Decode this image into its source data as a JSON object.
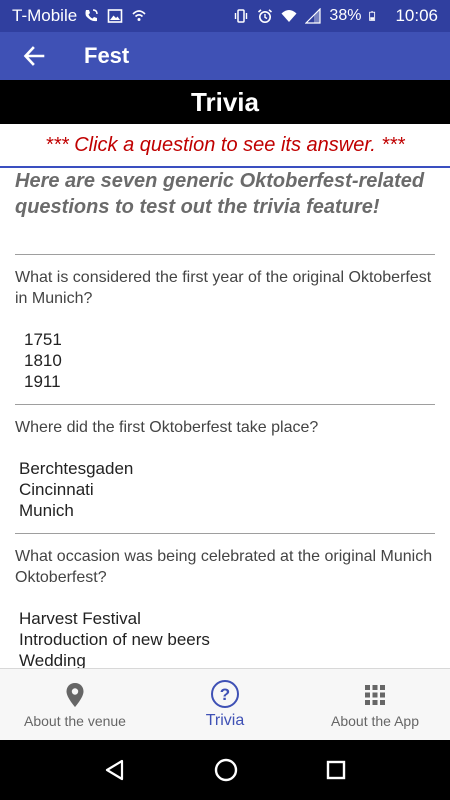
{
  "status_bar": {
    "carrier": "T-Mobile",
    "battery_percent": "38%",
    "time": "10:06",
    "icons": [
      "wifi-calling-icon",
      "image-icon",
      "hotspot-icon",
      "vibrate-icon",
      "alarm-icon",
      "wifi-icon",
      "signal-icon",
      "battery-icon"
    ]
  },
  "app_bar": {
    "title": "Fest",
    "back_icon": "arrow-back-icon"
  },
  "banner": {
    "title": "Trivia"
  },
  "hint": {
    "text": "*** Click a question to see its answer. ***"
  },
  "intro": {
    "text": "Here are seven generic Oktoberfest-related questions to test out the trivia feature!"
  },
  "questions": [
    {
      "question": "What is considered the first year of the original Oktoberfest in Munich?",
      "answers": [
        "1751",
        "1810",
        "1911"
      ]
    },
    {
      "question": "Where did the first Oktoberfest take place?",
      "answers": [
        "Berchtesgaden",
        "Cincinnati",
        "Munich"
      ]
    },
    {
      "question": "What occasion was being celebrated at the original Munich Oktoberfest?",
      "answers": [
        "Harvest Festival",
        "Introduction of new beers",
        "Wedding"
      ]
    }
  ],
  "bottom_nav": {
    "items": [
      {
        "label": "About the venue",
        "icon": "location-pin-icon",
        "active": false
      },
      {
        "label": "Trivia",
        "icon": "question-circle-icon",
        "active": true
      },
      {
        "label": "About the App",
        "icon": "grid-icon",
        "active": false
      }
    ]
  },
  "colors": {
    "status_bar": "#303f9f",
    "app_bar": "#3f51b5",
    "accent": "#3f51b5",
    "hint_text": "#c00000",
    "banner_bg": "#000000"
  }
}
